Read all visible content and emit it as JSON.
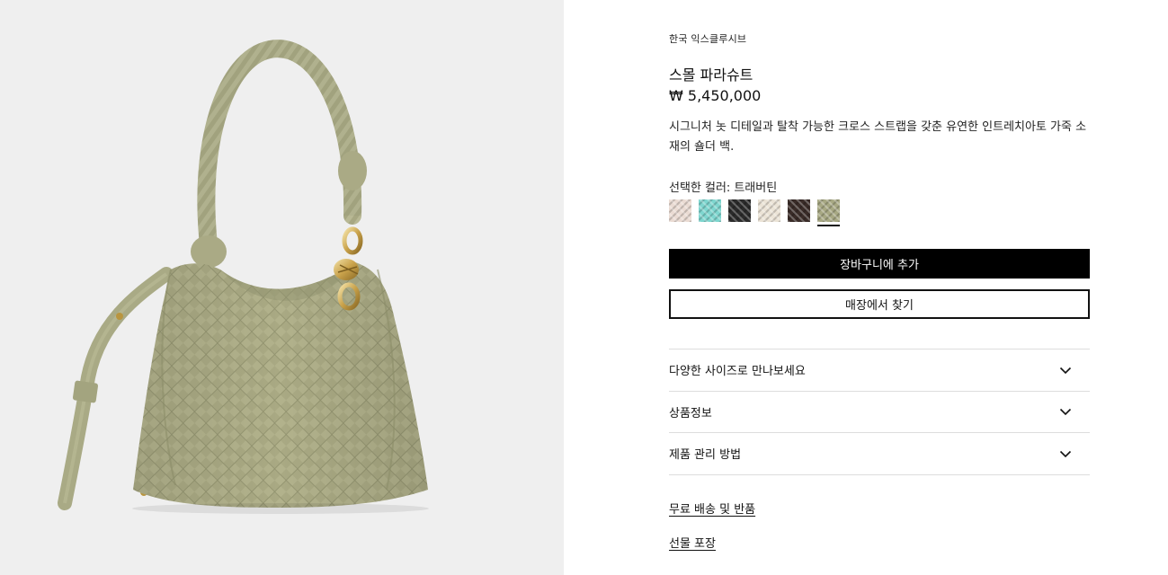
{
  "product": {
    "brand_line": "한국 익스클루시브",
    "name": "스몰 파라슈트",
    "price": "₩ 5,450,000",
    "description": "시그니처 놋 디테일과 탈착 가능한 크로스 스트랩을 갖춘 유연한 인트레치아토 가죽 소재의 숄더 백."
  },
  "color": {
    "label": "선택한 컬러:",
    "selected_name": "트래버틴",
    "swatches": [
      {
        "color": "#eadbd3"
      },
      {
        "color": "#7ed6cf"
      },
      {
        "color": "#2b2b2b"
      },
      {
        "color": "#ebe3d6"
      },
      {
        "color": "#3a2c28"
      },
      {
        "color": "#a7a883",
        "selected": true
      }
    ]
  },
  "actions": {
    "add_to_cart": "장바구니에 추가",
    "find_in_store": "매장에서 찾기"
  },
  "accordion": [
    {
      "label": "다양한 사이즈로 만나보세요"
    },
    {
      "label": "상품정보"
    },
    {
      "label": "제품 관리 방법"
    }
  ],
  "links": {
    "shipping": "무료 배송 및 반품",
    "gift": "선물 포장"
  },
  "image": {
    "bag_color": "#b4b48f",
    "background": "#efefef"
  }
}
